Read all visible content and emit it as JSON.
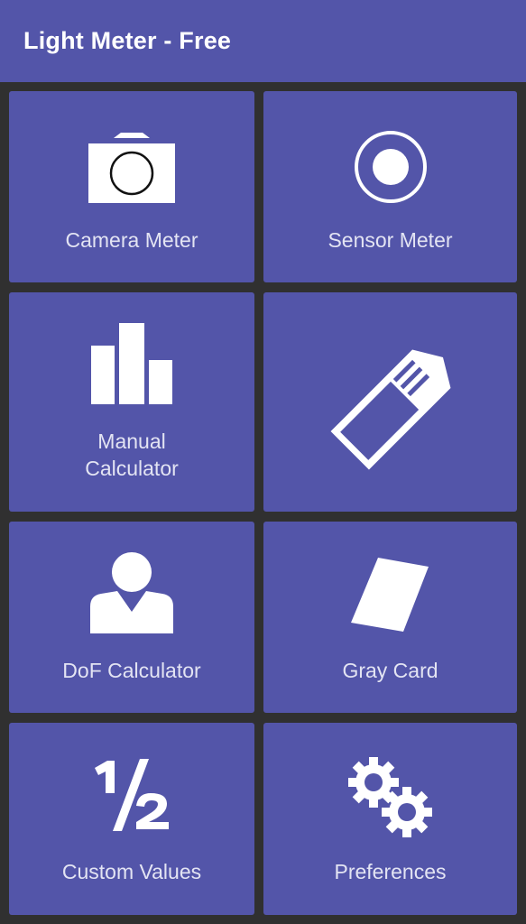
{
  "app_bar": {
    "title": "Light Meter - Free"
  },
  "tiles": {
    "camera_meter": {
      "label": "Camera Meter",
      "icon": "camera-icon"
    },
    "sensor_meter": {
      "label": "Sensor Meter",
      "icon": "record-icon"
    },
    "manual_calculator": {
      "label_line1": "Manual",
      "label_line2": "Calculator",
      "icon": "bar-chart-icon"
    },
    "tag": {
      "icon": "tag-icon"
    },
    "dof_calculator": {
      "label": "DoF Calculator",
      "icon": "person-icon"
    },
    "gray_card": {
      "label": "Gray Card",
      "icon": "card-icon"
    },
    "custom_values": {
      "label": "Custom Values",
      "icon": "one-half-icon",
      "icon_glyph": "½"
    },
    "preferences": {
      "label": "Preferences",
      "icon": "gears-icon"
    }
  },
  "colors": {
    "tile_background": "#5355a9",
    "page_background": "#303030",
    "label_text": "#e3e4f3",
    "icon": "#ffffff"
  }
}
